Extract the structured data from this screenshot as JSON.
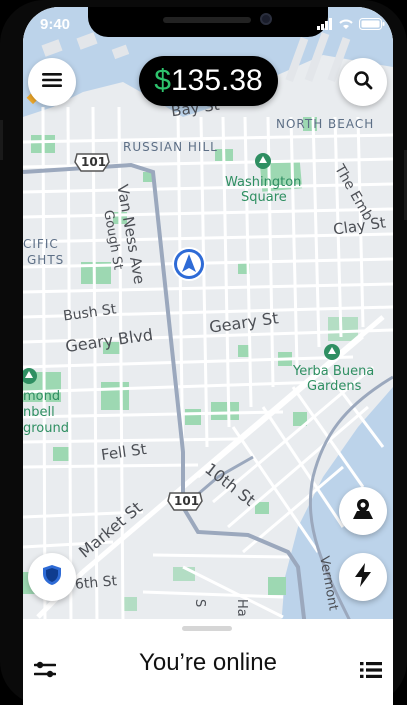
{
  "status_bar": {
    "time": "9:40"
  },
  "earnings": {
    "currency_symbol": "$",
    "amount": "135.38"
  },
  "map": {
    "neighborhoods": [
      "NORTH BEACH",
      "RUSSIAN HILL",
      "CIFIC",
      "GHTS"
    ],
    "parks": [
      "Washington",
      "Square",
      "Yerba Buena",
      "Gardens",
      "mond",
      "nbell",
      "ground"
    ],
    "streets": [
      "Bay St",
      "Clay St",
      "The Emb",
      "Van Ness Ave",
      "Gough St",
      "Bush St",
      "Geary Blvd",
      "Geary St",
      "Fell St",
      "Market St",
      "10th St",
      "Vermont",
      "6th St",
      "S",
      "Ha"
    ],
    "highway_shields": [
      "101",
      "101"
    ],
    "accent_color": "#2e6bd6"
  },
  "bottom_sheet": {
    "status": "You’re online"
  }
}
